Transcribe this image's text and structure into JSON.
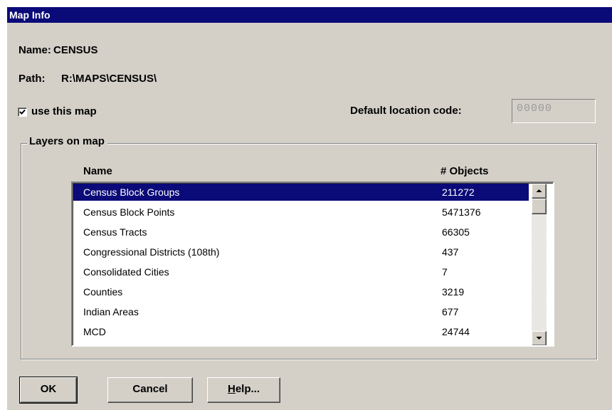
{
  "window": {
    "title": "Map Info"
  },
  "map": {
    "name_caption": "Name:",
    "name_value": "CENSUS",
    "path_caption": "Path:",
    "path_value": "R:\\MAPS\\CENSUS\\"
  },
  "use_map": {
    "label": "use this map",
    "checked": true
  },
  "default_location": {
    "label": "Default location code:",
    "value": "00000"
  },
  "layers": {
    "group_title": "Layers on map",
    "columns": {
      "name": "Name",
      "objects": "# Objects"
    },
    "rows": [
      {
        "name": "Census Block Groups",
        "objects": "211272",
        "selected": true
      },
      {
        "name": "Census Block Points",
        "objects": "5471376"
      },
      {
        "name": "Census Tracts",
        "objects": "66305"
      },
      {
        "name": "Congressional Districts (108th)",
        "objects": "437"
      },
      {
        "name": "Consolidated Cities",
        "objects": "7"
      },
      {
        "name": "Counties",
        "objects": "3219"
      },
      {
        "name": "Indian Areas",
        "objects": "677"
      },
      {
        "name": "MCD",
        "objects": "24744"
      }
    ]
  },
  "buttons": {
    "ok": "OK",
    "cancel": "Cancel",
    "help_mnemonic": "H",
    "help_rest": "elp..."
  },
  "icons": {
    "checkbox": "checkmark-icon",
    "scroll_up": "arrow-up-icon",
    "scroll_down": "arrow-down-icon"
  }
}
